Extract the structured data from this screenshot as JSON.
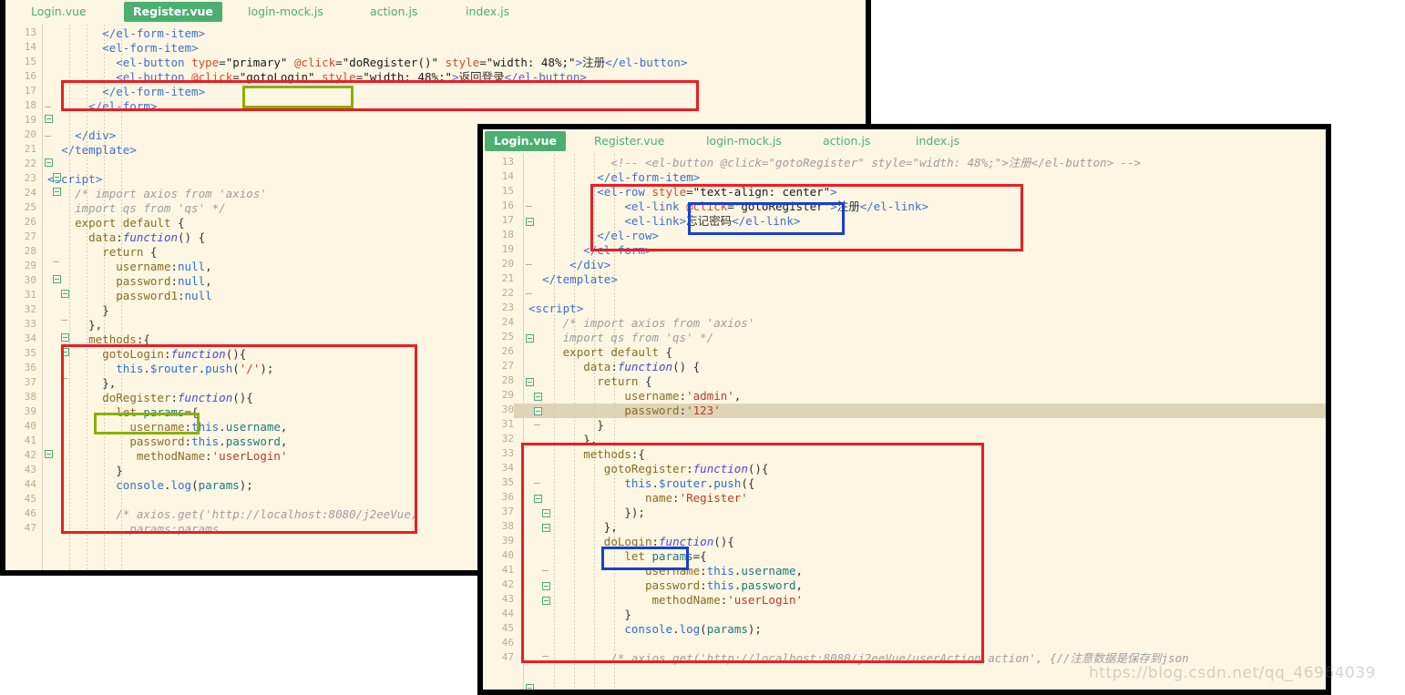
{
  "colors": {
    "editor_background": "#fdf6e3",
    "active_tab_background": "#4caf72",
    "tab_text": "#4caf72",
    "annotation_red": "#ed1c24",
    "annotation_olive": "#8ab000",
    "annotation_blue": "#1a3fd0",
    "highlight_line": "#ded5b8",
    "window_border": "#000000",
    "line_number": "#b9ae8c"
  },
  "watermark": "https://blog.csdn.net/qq_46964039",
  "back_window": {
    "title": "Register.vue",
    "tabs": [
      {
        "label": "Login.vue",
        "active": false
      },
      {
        "label": "Register.vue",
        "active": true
      },
      {
        "label": "login-mock.js",
        "active": false
      },
      {
        "label": "action.js",
        "active": false
      },
      {
        "label": "index.js",
        "active": false
      }
    ],
    "first_line_number": 13,
    "lines": [
      {
        "n": 13,
        "text": "        </el-form-item>"
      },
      {
        "n": 14,
        "text": "        <el-form-item>"
      },
      {
        "n": 15,
        "text": "          <el-button type=\"primary\" @click=\"doRegister()\" style=\"width: 48%;\">注册</el-button>"
      },
      {
        "n": 16,
        "text": "          <el-button @click=\"gotoLogin\" style=\"width: 48%;\">返回登录</el-button>"
      },
      {
        "n": 17,
        "text": "        </el-form-item>"
      },
      {
        "n": 18,
        "text": "      </el-form>"
      },
      {
        "n": 19,
        "text": ""
      },
      {
        "n": 20,
        "text": "    </div>"
      },
      {
        "n": 21,
        "text": "  </template>"
      },
      {
        "n": 22,
        "text": ""
      },
      {
        "n": 23,
        "text": "<script>"
      },
      {
        "n": 24,
        "text": "    /* import axios from 'axios'"
      },
      {
        "n": 25,
        "text": "    import qs from 'qs' */"
      },
      {
        "n": 26,
        "text": "    export default {"
      },
      {
        "n": 27,
        "text": "      data:function() {"
      },
      {
        "n": 28,
        "text": "        return {"
      },
      {
        "n": 29,
        "text": "          username:null,"
      },
      {
        "n": 30,
        "text": "          password:null,"
      },
      {
        "n": 31,
        "text": "          password1:null"
      },
      {
        "n": 32,
        "text": "        }"
      },
      {
        "n": 33,
        "text": "      },"
      },
      {
        "n": 34,
        "text": "      methods:{"
      },
      {
        "n": 35,
        "text": "        gotoLogin:function(){"
      },
      {
        "n": 36,
        "text": "          this.$router.push('/');"
      },
      {
        "n": 37,
        "text": "        },"
      },
      {
        "n": 38,
        "text": "        doRegister:function(){"
      },
      {
        "n": 39,
        "text": "          let params={"
      },
      {
        "n": 40,
        "text": "            username:this.username,"
      },
      {
        "n": 41,
        "text": "            password:this.password,"
      },
      {
        "n": 42,
        "text": "             methodName:'userLogin'"
      },
      {
        "n": 43,
        "text": "          }"
      },
      {
        "n": 44,
        "text": "          console.log(params);"
      },
      {
        "n": 45,
        "text": ""
      },
      {
        "n": 46,
        "text": "          /* axios.get('http://localhost:8080/j2eeVue,"
      },
      {
        "n": 47,
        "text": "            params:params"
      }
    ],
    "annotations": [
      {
        "kind": "red-box",
        "target": "lines-16-17-el-button-gotoLogin-block"
      },
      {
        "kind": "olive-box",
        "target": "gotoLogin-attribute-value"
      },
      {
        "kind": "red-box",
        "target": "methods-block-lines-33-45"
      },
      {
        "kind": "olive-box",
        "target": "doRegister-method-name"
      }
    ]
  },
  "front_window": {
    "title": "Login.vue",
    "tabs": [
      {
        "label": "Login.vue",
        "active": true
      },
      {
        "label": "Register.vue",
        "active": false
      },
      {
        "label": "login-mock.js",
        "active": false
      },
      {
        "label": "action.js",
        "active": false
      },
      {
        "label": "index.js",
        "active": false
      }
    ],
    "first_line_number": 13,
    "highlighted_line": 30,
    "lines": [
      {
        "n": 13,
        "text": "            <!-- <el-button @click=\"gotoRegister\" style=\"width: 48%;\">注册</el-button> -->"
      },
      {
        "n": 14,
        "text": "          </el-form-item>"
      },
      {
        "n": 15,
        "text": "          <el-row style=\"text-align: center\">"
      },
      {
        "n": 16,
        "text": "              <el-link @click=\"gotoRegister\">注册</el-link>"
      },
      {
        "n": 17,
        "text": "              <el-link>忘记密码</el-link>"
      },
      {
        "n": 18,
        "text": "          </el-row>"
      },
      {
        "n": 19,
        "text": "        </el-form>"
      },
      {
        "n": 20,
        "text": "      </div>"
      },
      {
        "n": 21,
        "text": "  </template>"
      },
      {
        "n": 22,
        "text": ""
      },
      {
        "n": 23,
        "text": "<script>"
      },
      {
        "n": 24,
        "text": "     /* import axios from 'axios'"
      },
      {
        "n": 25,
        "text": "     import qs from 'qs' */"
      },
      {
        "n": 26,
        "text": "     export default {"
      },
      {
        "n": 27,
        "text": "        data:function() {"
      },
      {
        "n": 28,
        "text": "          return {"
      },
      {
        "n": 29,
        "text": "              username:'admin',"
      },
      {
        "n": 30,
        "text": "              password:'123'"
      },
      {
        "n": 31,
        "text": "          }"
      },
      {
        "n": 32,
        "text": "        },"
      },
      {
        "n": 33,
        "text": "        methods:{"
      },
      {
        "n": 34,
        "text": "           gotoRegister:function(){"
      },
      {
        "n": 35,
        "text": "              this.$router.push({"
      },
      {
        "n": 36,
        "text": "                 name:'Register'"
      },
      {
        "n": 37,
        "text": "              });"
      },
      {
        "n": 38,
        "text": "           },"
      },
      {
        "n": 39,
        "text": "           doLogin:function(){"
      },
      {
        "n": 40,
        "text": "              let params={"
      },
      {
        "n": 41,
        "text": "                 username:this.username,"
      },
      {
        "n": 42,
        "text": "                 password:this.password,"
      },
      {
        "n": 43,
        "text": "                  methodName:'userLogin'"
      },
      {
        "n": 44,
        "text": "              }"
      },
      {
        "n": 45,
        "text": "              console.log(params);"
      },
      {
        "n": 46,
        "text": ""
      },
      {
        "n": 47,
        "text": "            /* axios.get('http://localhost:8080/j2eeVue/userAction.action', {//注意数据是保存到json"
      }
    ],
    "annotations": [
      {
        "kind": "red-box",
        "target": "el-row-block-lines-14-18"
      },
      {
        "kind": "blue-box",
        "target": "text-align-center-and-gotoRegister"
      },
      {
        "kind": "red-box",
        "target": "methods-block-lines-32-46"
      },
      {
        "kind": "blue-box",
        "target": "doLogin-method-name"
      }
    ]
  }
}
